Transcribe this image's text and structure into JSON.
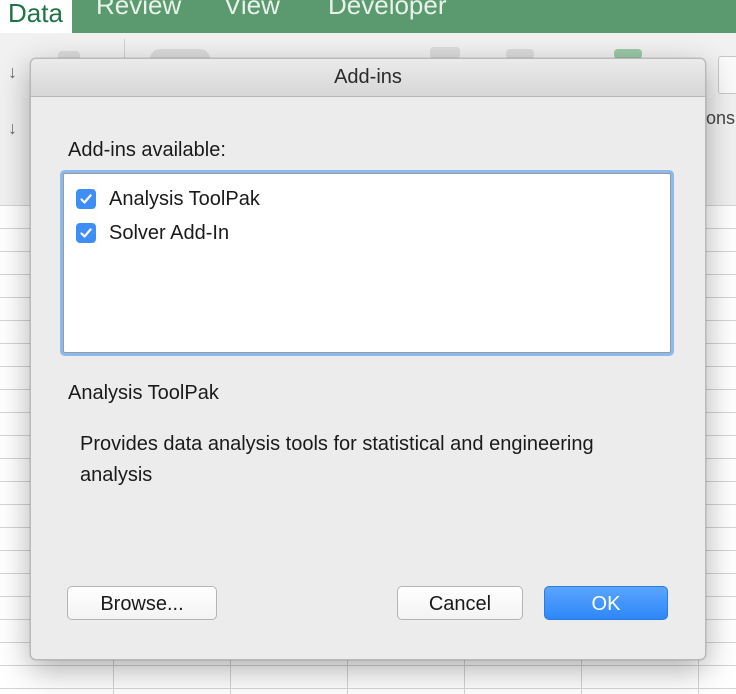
{
  "background_app": {
    "tabs": [
      {
        "label": "Data"
      },
      {
        "label": "Review"
      },
      {
        "label": "View"
      },
      {
        "label": "Developer"
      }
    ],
    "ribbon_partial_text": "ons",
    "accent_color": "#217346",
    "tab_strip_color": "#5b9a6f"
  },
  "dialog": {
    "title": "Add-ins",
    "available_label": "Add-ins available:",
    "addins": [
      {
        "label": "Analysis ToolPak",
        "checked": true
      },
      {
        "label": "Solver Add-In",
        "checked": true
      }
    ],
    "selected_name": "Analysis ToolPak",
    "description": "Provides data analysis tools for statistical and engineering analysis",
    "buttons": {
      "browse": "Browse...",
      "cancel": "Cancel",
      "ok": "OK"
    },
    "checkbox_color": "#3f8ef7",
    "focus_ring_color": "#8db9f1",
    "default_button_color": "#2e87f7",
    "icons": {
      "checkbox": "checkmark-icon",
      "ribbon_arrow": "down-arrow-icon"
    }
  }
}
